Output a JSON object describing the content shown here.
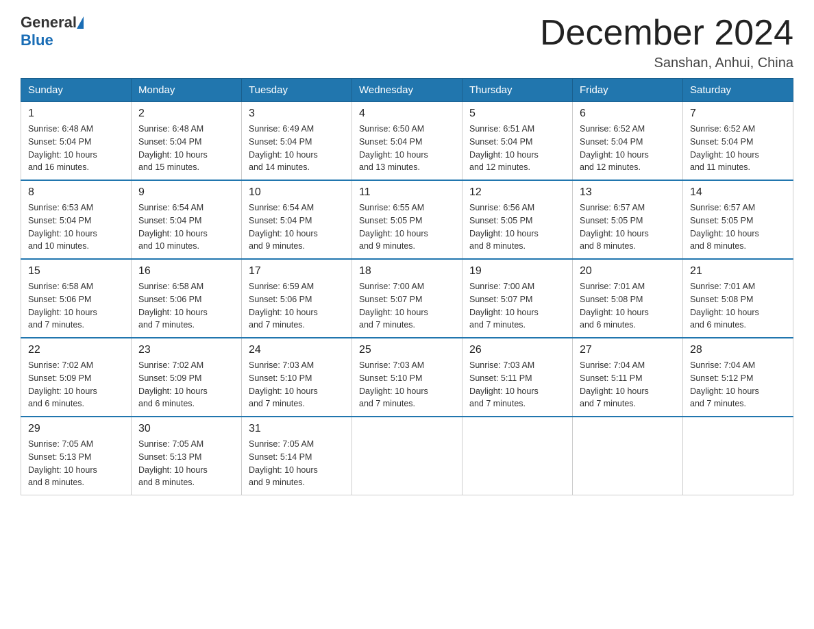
{
  "logo": {
    "text_general": "General",
    "text_blue": "Blue"
  },
  "title": "December 2024",
  "location": "Sanshan, Anhui, China",
  "days_of_week": [
    "Sunday",
    "Monday",
    "Tuesday",
    "Wednesday",
    "Thursday",
    "Friday",
    "Saturday"
  ],
  "weeks": [
    [
      {
        "day": "1",
        "sunrise": "6:48 AM",
        "sunset": "5:04 PM",
        "daylight": "10 hours and 16 minutes."
      },
      {
        "day": "2",
        "sunrise": "6:48 AM",
        "sunset": "5:04 PM",
        "daylight": "10 hours and 15 minutes."
      },
      {
        "day": "3",
        "sunrise": "6:49 AM",
        "sunset": "5:04 PM",
        "daylight": "10 hours and 14 minutes."
      },
      {
        "day": "4",
        "sunrise": "6:50 AM",
        "sunset": "5:04 PM",
        "daylight": "10 hours and 13 minutes."
      },
      {
        "day": "5",
        "sunrise": "6:51 AM",
        "sunset": "5:04 PM",
        "daylight": "10 hours and 12 minutes."
      },
      {
        "day": "6",
        "sunrise": "6:52 AM",
        "sunset": "5:04 PM",
        "daylight": "10 hours and 12 minutes."
      },
      {
        "day": "7",
        "sunrise": "6:52 AM",
        "sunset": "5:04 PM",
        "daylight": "10 hours and 11 minutes."
      }
    ],
    [
      {
        "day": "8",
        "sunrise": "6:53 AM",
        "sunset": "5:04 PM",
        "daylight": "10 hours and 10 minutes."
      },
      {
        "day": "9",
        "sunrise": "6:54 AM",
        "sunset": "5:04 PM",
        "daylight": "10 hours and 10 minutes."
      },
      {
        "day": "10",
        "sunrise": "6:54 AM",
        "sunset": "5:04 PM",
        "daylight": "10 hours and 9 minutes."
      },
      {
        "day": "11",
        "sunrise": "6:55 AM",
        "sunset": "5:05 PM",
        "daylight": "10 hours and 9 minutes."
      },
      {
        "day": "12",
        "sunrise": "6:56 AM",
        "sunset": "5:05 PM",
        "daylight": "10 hours and 8 minutes."
      },
      {
        "day": "13",
        "sunrise": "6:57 AM",
        "sunset": "5:05 PM",
        "daylight": "10 hours and 8 minutes."
      },
      {
        "day": "14",
        "sunrise": "6:57 AM",
        "sunset": "5:05 PM",
        "daylight": "10 hours and 8 minutes."
      }
    ],
    [
      {
        "day": "15",
        "sunrise": "6:58 AM",
        "sunset": "5:06 PM",
        "daylight": "10 hours and 7 minutes."
      },
      {
        "day": "16",
        "sunrise": "6:58 AM",
        "sunset": "5:06 PM",
        "daylight": "10 hours and 7 minutes."
      },
      {
        "day": "17",
        "sunrise": "6:59 AM",
        "sunset": "5:06 PM",
        "daylight": "10 hours and 7 minutes."
      },
      {
        "day": "18",
        "sunrise": "7:00 AM",
        "sunset": "5:07 PM",
        "daylight": "10 hours and 7 minutes."
      },
      {
        "day": "19",
        "sunrise": "7:00 AM",
        "sunset": "5:07 PM",
        "daylight": "10 hours and 7 minutes."
      },
      {
        "day": "20",
        "sunrise": "7:01 AM",
        "sunset": "5:08 PM",
        "daylight": "10 hours and 6 minutes."
      },
      {
        "day": "21",
        "sunrise": "7:01 AM",
        "sunset": "5:08 PM",
        "daylight": "10 hours and 6 minutes."
      }
    ],
    [
      {
        "day": "22",
        "sunrise": "7:02 AM",
        "sunset": "5:09 PM",
        "daylight": "10 hours and 6 minutes."
      },
      {
        "day": "23",
        "sunrise": "7:02 AM",
        "sunset": "5:09 PM",
        "daylight": "10 hours and 6 minutes."
      },
      {
        "day": "24",
        "sunrise": "7:03 AM",
        "sunset": "5:10 PM",
        "daylight": "10 hours and 7 minutes."
      },
      {
        "day": "25",
        "sunrise": "7:03 AM",
        "sunset": "5:10 PM",
        "daylight": "10 hours and 7 minutes."
      },
      {
        "day": "26",
        "sunrise": "7:03 AM",
        "sunset": "5:11 PM",
        "daylight": "10 hours and 7 minutes."
      },
      {
        "day": "27",
        "sunrise": "7:04 AM",
        "sunset": "5:11 PM",
        "daylight": "10 hours and 7 minutes."
      },
      {
        "day": "28",
        "sunrise": "7:04 AM",
        "sunset": "5:12 PM",
        "daylight": "10 hours and 7 minutes."
      }
    ],
    [
      {
        "day": "29",
        "sunrise": "7:05 AM",
        "sunset": "5:13 PM",
        "daylight": "10 hours and 8 minutes."
      },
      {
        "day": "30",
        "sunrise": "7:05 AM",
        "sunset": "5:13 PM",
        "daylight": "10 hours and 8 minutes."
      },
      {
        "day": "31",
        "sunrise": "7:05 AM",
        "sunset": "5:14 PM",
        "daylight": "10 hours and 9 minutes."
      },
      null,
      null,
      null,
      null
    ]
  ],
  "labels": {
    "sunrise": "Sunrise:",
    "sunset": "Sunset:",
    "daylight": "Daylight:"
  }
}
